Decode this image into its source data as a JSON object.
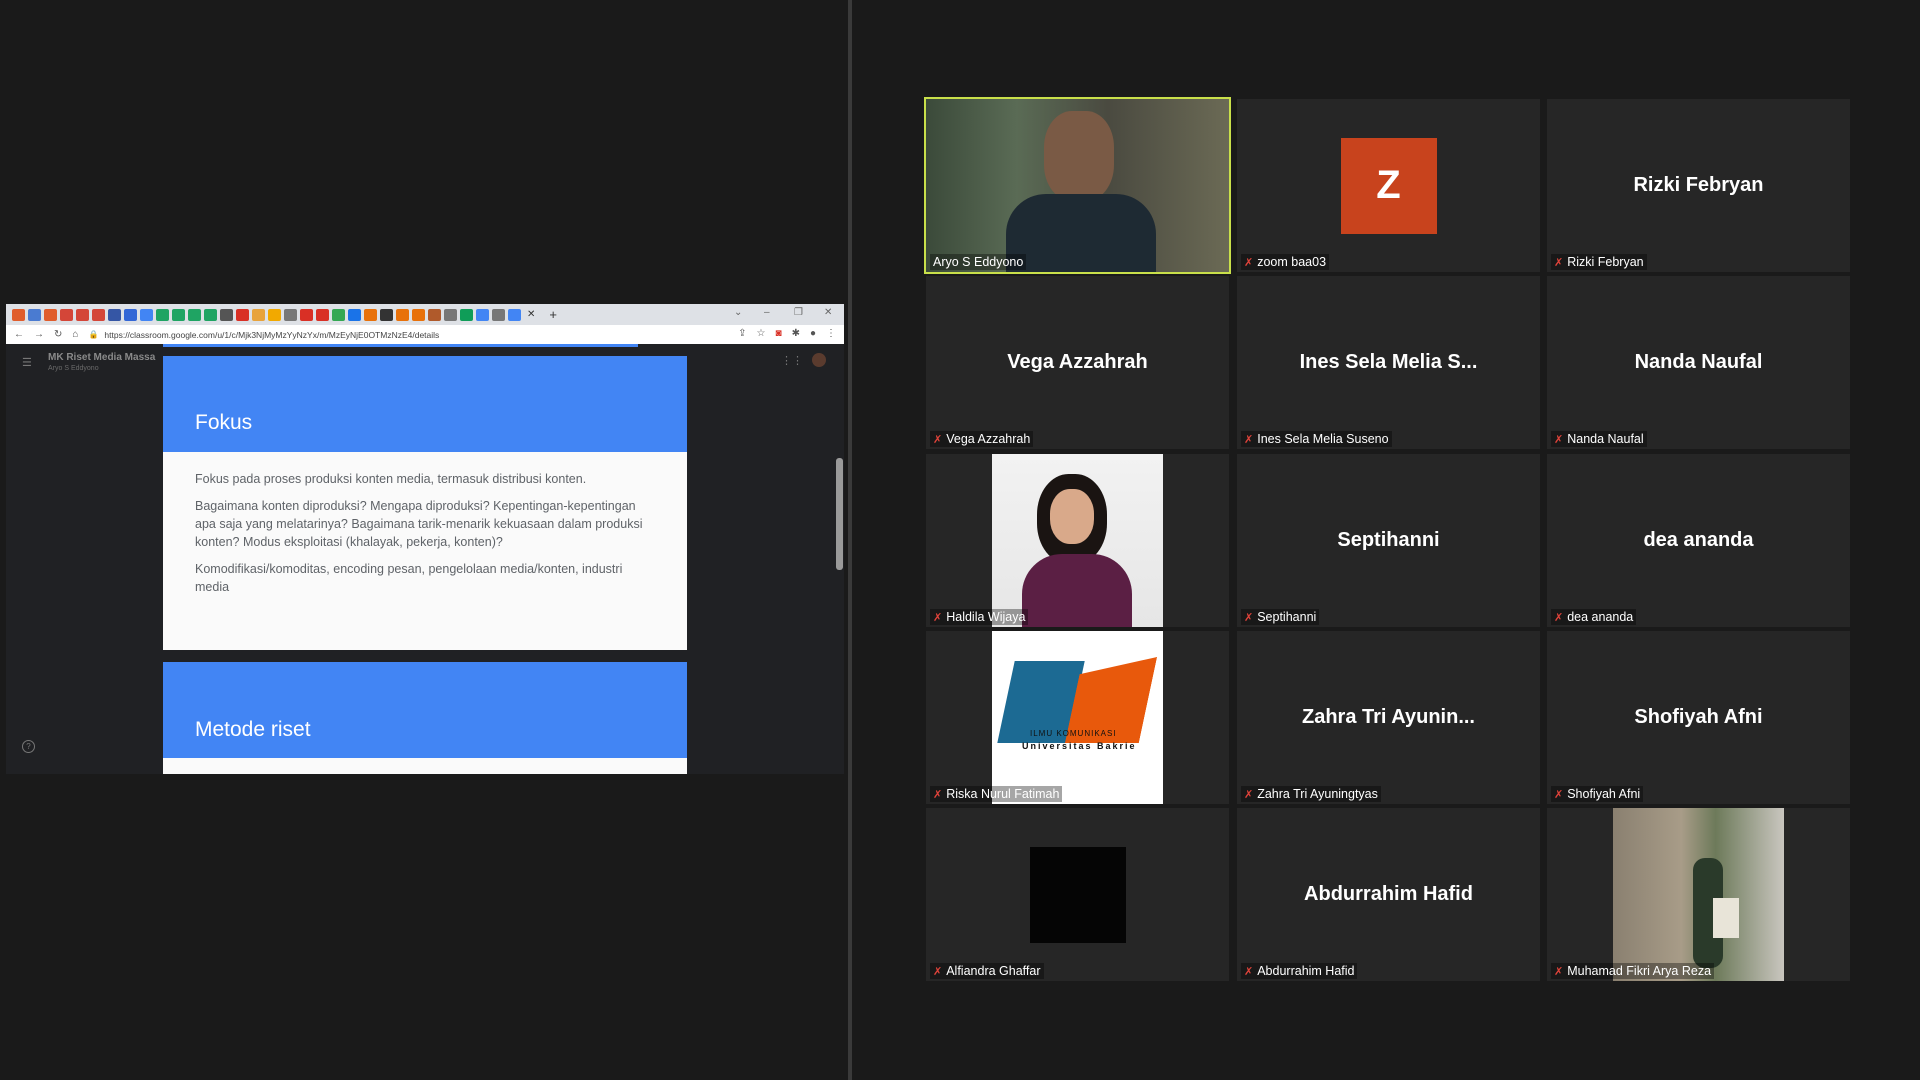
{
  "share": {
    "tabs_favicons": [
      {
        "icon": "shield-icon",
        "color": "#e05d2c"
      },
      {
        "icon": "window-icon",
        "color": "#4a7bd1"
      },
      {
        "icon": "shield-icon",
        "color": "#e05d2c"
      },
      {
        "icon": "gmail-icon",
        "color": "#d44638"
      },
      {
        "icon": "gmail-icon",
        "color": "#d44638"
      },
      {
        "icon": "gmail-icon",
        "color": "#d44638"
      },
      {
        "icon": "mail-icon",
        "color": "#3556a5"
      },
      {
        "icon": "s-icon",
        "color": "#3367d6"
      },
      {
        "icon": "doc-icon",
        "color": "#4285f4"
      },
      {
        "icon": "drive-icon",
        "color": "#1fa463"
      },
      {
        "icon": "drive-icon",
        "color": "#1fa463"
      },
      {
        "icon": "drive-icon",
        "color": "#1fa463"
      },
      {
        "icon": "drive-icon",
        "color": "#1fa463"
      },
      {
        "icon": "grid-icon",
        "color": "#555555"
      },
      {
        "icon": "pdf-icon",
        "color": "#d93025"
      },
      {
        "icon": "image-icon",
        "color": "#e8a33b"
      },
      {
        "icon": "circle-icon",
        "color": "#f2a900"
      },
      {
        "icon": "globe-icon",
        "color": "#777777"
      },
      {
        "icon": "circle-icon",
        "color": "#d93025"
      },
      {
        "icon": "shield-icon",
        "color": "#d93025"
      },
      {
        "icon": "plus-circle-icon",
        "color": "#34a853"
      },
      {
        "icon": "globe-icon",
        "color": "#1a73e8"
      },
      {
        "icon": "orange-icon",
        "color": "#e8710a"
      },
      {
        "icon": "bag-icon",
        "color": "#333333"
      },
      {
        "icon": "orange-icon",
        "color": "#e8710a"
      },
      {
        "icon": "orange-icon",
        "color": "#e8710a"
      },
      {
        "icon": "grid-icon",
        "color": "#b05a2b"
      },
      {
        "icon": "globe-icon",
        "color": "#777777"
      },
      {
        "icon": "sheet-icon",
        "color": "#0f9d58"
      },
      {
        "icon": "g-icon",
        "color": "#4285f4"
      },
      {
        "icon": "globe-icon",
        "color": "#777777"
      },
      {
        "icon": "g-icon",
        "color": "#4285f4"
      }
    ],
    "url": "https://classroom.google.com/u/1/c/Mjk3NjMyMzYyNzYx/m/MzEyNjE0OTMzNzE4/details",
    "class_title": "MK Riset Media Massa",
    "class_subtitle": "Aryo S Eddyono",
    "cards": [
      {
        "title": "Fokus",
        "paragraphs": [
          "Fokus pada proses produksi konten media, termasuk distribusi konten.",
          "Bagaimana konten diproduksi? Mengapa diproduksi? Kepentingan-kepentingan apa saja yang melatarinya? Bagaimana tarik-menarik kekuasaan dalam produksi konten? Modus eksploitasi (khalayak, pekerja, konten)?",
          "Komodifikasi/komoditas, encoding pesan, pengelolaan media/konten, industri media"
        ]
      },
      {
        "title": "Metode riset"
      }
    ]
  },
  "participants": [
    {
      "name": "Aryo S Eddyono",
      "display": "video",
      "muted": false,
      "active": true
    },
    {
      "name": "zoom baa03",
      "display": "initial",
      "initial": "Z",
      "avatar_color": "#c8431d",
      "muted": true
    },
    {
      "name": "Rizki Febryan",
      "display": "name",
      "muted": true
    },
    {
      "name": "Vega Azzahrah",
      "display": "name",
      "muted": true
    },
    {
      "name": "Ines Sela Melia Suseno",
      "center_text": "Ines Sela Melia S...",
      "display": "name",
      "muted": true
    },
    {
      "name": "Nanda Naufal",
      "display": "name",
      "muted": true
    },
    {
      "name": "Haldila Wijaya",
      "display": "photo",
      "muted": true
    },
    {
      "name": "Septihanni",
      "display": "name",
      "muted": true
    },
    {
      "name": "dea ananda",
      "display": "name",
      "muted": true
    },
    {
      "name": "Riska Nurul Fatimah",
      "display": "logo",
      "logo_text_1": "ILMU KOMUNIKASI",
      "logo_text_2": "Universitas Bakrie",
      "muted": true
    },
    {
      "name": "Zahra Tri Ayuningtyas",
      "center_text": "Zahra Tri Ayunin...",
      "display": "name",
      "muted": true
    },
    {
      "name": "Shofiyah Afni",
      "display": "name",
      "muted": true
    },
    {
      "name": "Alfiandra Ghaffar",
      "display": "dark-photo",
      "muted": true
    },
    {
      "name": "Abdurrahim Hafid",
      "display": "name",
      "muted": true
    },
    {
      "name": "Muhamad Fikri Arya Reza",
      "display": "photo",
      "muted": true
    }
  ],
  "colors": {
    "active_border": "#c9e04a",
    "card_header": "#4285f4",
    "mute_icon": "#e0433a"
  }
}
